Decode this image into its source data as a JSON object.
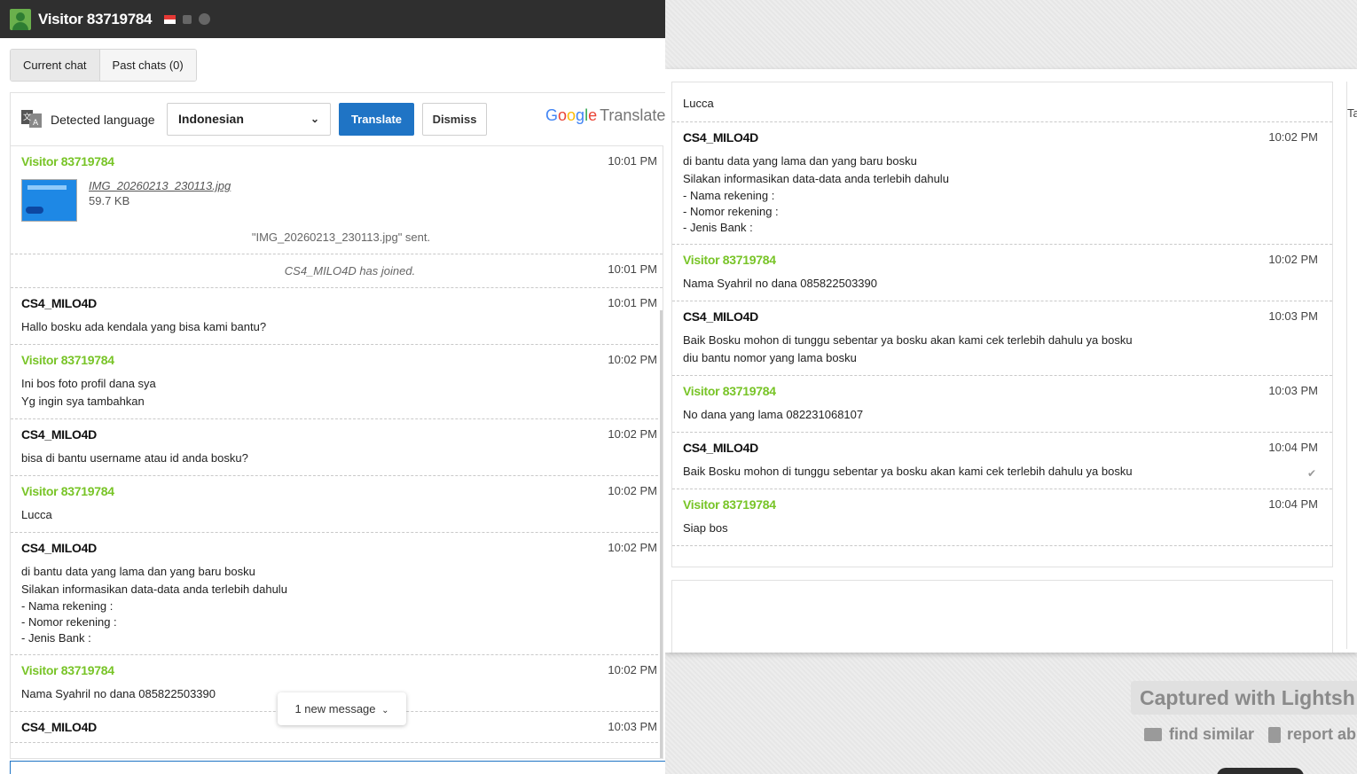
{
  "window": {
    "title": "Visitor 83719784",
    "flag_icon": "flag-indonesia-icon"
  },
  "tabs": [
    {
      "label": "Current chat"
    },
    {
      "label": "Past chats (0)"
    }
  ],
  "translate": {
    "detected_label": "Detected language",
    "selected_language": "Indonesian",
    "translate_label": "Translate",
    "dismiss_label": "Dismiss",
    "brand_google": "Google",
    "brand_translate": "Translate"
  },
  "left_chat": {
    "file_message": {
      "sender": "Visitor 83719784",
      "time": "10:01 PM",
      "file_name": "IMG_20260213_230113.jpg",
      "file_size": "59.7 KB",
      "sent_note": "\"IMG_20260213_230113.jpg\" sent."
    },
    "system_message": {
      "text": "CS4_MILO4D has joined.",
      "time": "10:01 PM"
    },
    "messages": [
      {
        "sender": "CS4_MILO4D",
        "time": "10:01 PM",
        "lines": [
          "Hallo bosku ada kendala yang bisa kami bantu?"
        ]
      },
      {
        "sender": "Visitor 83719784",
        "time": "10:02 PM",
        "lines": [
          "Ini bos foto profil dana sya",
          "Yg ingin sya tambahkan"
        ]
      },
      {
        "sender": "CS4_MILO4D",
        "time": "10:02 PM",
        "lines": [
          "bisa di bantu username atau id anda bosku?"
        ]
      },
      {
        "sender": "Visitor 83719784",
        "time": "10:02 PM",
        "lines": [
          "Lucca"
        ]
      },
      {
        "sender": "CS4_MILO4D",
        "time": "10:02 PM",
        "lines": [
          "di bantu data yang lama dan yang baru bosku",
          "Silakan informasikan data-data anda terlebih dahulu",
          "- Nama rekening :",
          "- Nomor rekening :",
          "- Jenis Bank :"
        ]
      },
      {
        "sender": "Visitor 83719784",
        "time": "10:02 PM",
        "lines": [
          "Nama Syahril no dana 085822503390"
        ]
      },
      {
        "sender": "CS4_MILO4D",
        "time": "10:03 PM",
        "lines": []
      }
    ],
    "new_message_label": "1 new message"
  },
  "right_chat": {
    "top_line": "Lucca",
    "messages": [
      {
        "sender": "CS4_MILO4D",
        "time": "10:02 PM",
        "lines": [
          "di bantu data yang lama dan yang baru bosku",
          "Silakan informasikan data-data anda terlebih dahulu",
          "- Nama rekening :",
          "- Nomor rekening :",
          "- Jenis Bank :"
        ]
      },
      {
        "sender": "Visitor 83719784",
        "time": "10:02 PM",
        "lines": [
          "Nama Syahril no dana 085822503390"
        ]
      },
      {
        "sender": "CS4_MILO4D",
        "time": "10:03 PM",
        "lines": [
          "Baik Bosku mohon di tunggu sebentar ya bosku akan kami cek terlebih dahulu ya bosku",
          "diu bantu nomor yang lama bosku"
        ]
      },
      {
        "sender": "Visitor 83719784",
        "time": "10:03 PM",
        "lines": [
          "No dana yang lama 082231068107"
        ]
      },
      {
        "sender": "CS4_MILO4D",
        "time": "10:04 PM",
        "lines": [
          "Baik Bosku mohon di tunggu sebentar ya bosku akan kami cek terlebih dahulu ya bosku"
        ]
      },
      {
        "sender": "Visitor 83719784",
        "time": "10:04 PM",
        "lines": [
          "Siap bos"
        ]
      }
    ],
    "side_label": "Ta"
  },
  "lightshot": {
    "captured": "Captured with Lightsh",
    "find_similar": "find similar",
    "report": "report abu"
  }
}
